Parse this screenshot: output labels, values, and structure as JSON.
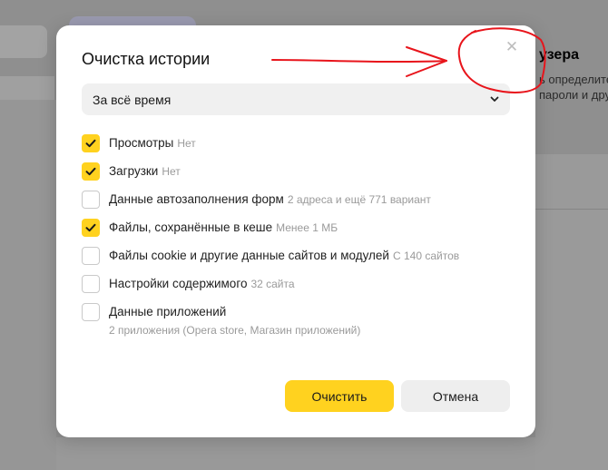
{
  "background": {
    "title_fragment": "узера",
    "line1_fragment": "ь определите",
    "line2_fragment": "пароли и дру"
  },
  "dialog": {
    "title": "Очистка истории",
    "close_icon": "close-icon",
    "period": {
      "selected": "За всё время"
    },
    "options": [
      {
        "label": "Просмотры",
        "hint": "Нет",
        "checked": true
      },
      {
        "label": "Загрузки",
        "hint": "Нет",
        "checked": true
      },
      {
        "label": "Данные автозаполнения форм",
        "hint": "2 адреса и ещё 771 вариант",
        "checked": false
      },
      {
        "label": "Файлы, сохранённые в кеше",
        "hint": "Менее 1 МБ",
        "checked": true
      },
      {
        "label": "Файлы cookie и другие данные сайтов и модулей",
        "hint": "С 140 сайтов",
        "checked": false
      },
      {
        "label": "Настройки содержимого",
        "hint": "32 сайта",
        "checked": false
      },
      {
        "label": "Данные приложений",
        "sub": "2 приложения (Opera store, Магазин приложений)",
        "checked": false
      }
    ],
    "clear_button": "Очистить",
    "cancel_button": "Отмена"
  },
  "colors": {
    "accent": "#ffd21f",
    "annotation": "#e8141b",
    "overlay": "#8f8f8f"
  }
}
